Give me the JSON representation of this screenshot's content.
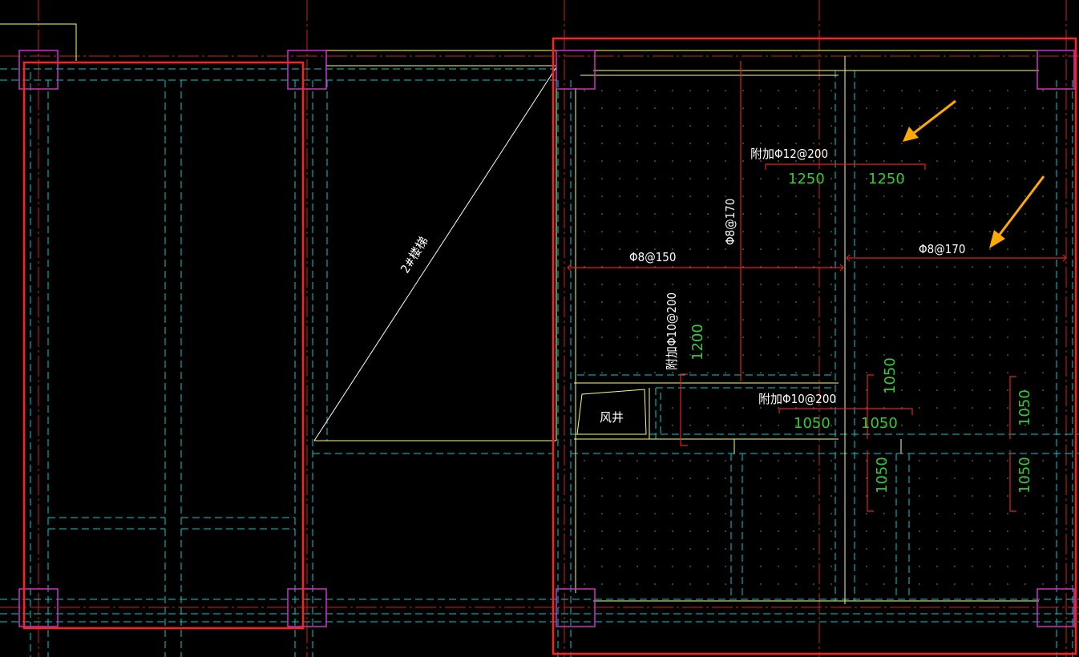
{
  "labels": {
    "stair": "2#楼梯",
    "shaft": "风井",
    "extra_rebar_12": "附加Φ12@200",
    "extra_rebar_10_v": "附加Φ10@200",
    "extra_rebar_10_h": "附加Φ10@200",
    "rebar_8_150": "Φ8@150",
    "rebar_8_170_v": "Φ8@170",
    "rebar_8_170_h": "Φ8@170"
  },
  "dimensions": {
    "d1250_left": "1250",
    "d1250_right": "1250",
    "d1200": "1200",
    "d1050_a": "1050",
    "d1050_b": "1050",
    "d1050_c": "1050",
    "d1050_d": "1050",
    "d1050_e": "1050",
    "d1050_f": "1050"
  },
  "colors": {
    "background": "#000000",
    "beam_dashed": "#00cccc",
    "axis": "#cc1f1f",
    "wall": "#ffff66",
    "column": "#cc33cc",
    "highlight": "#ff2020",
    "rebar_text": "#ffffff",
    "dimension_text": "#33cc33",
    "arrow": "#ffaa00"
  },
  "icons": [
    "arrow-annotation-1",
    "arrow-annotation-2"
  ]
}
